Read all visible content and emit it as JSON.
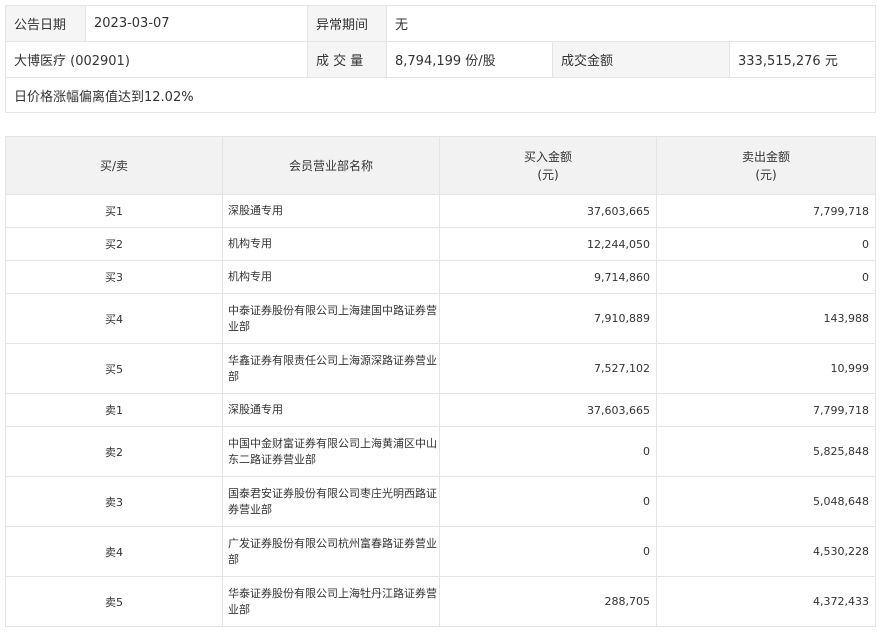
{
  "info": {
    "date_label": "公告日期",
    "date_value": "2023-03-07",
    "period_label": "异常期间",
    "period_value": "无",
    "stock_name": "大博医疗 (002901)",
    "volume_label": "成 交 量",
    "volume_value": "8,794,199 份/股",
    "amount_label": "成交金额",
    "amount_value": "333,515,276 元",
    "note": "日价格涨幅偏离值达到12.02%"
  },
  "table": {
    "headers": {
      "side": "买/卖",
      "dept": "会员营业部名称",
      "buy_line1": "买入金额",
      "buy_line2": "(元)",
      "sell_line1": "卖出金额",
      "sell_line2": "(元)"
    },
    "rows": [
      {
        "side": "买1",
        "dept": "深股通专用",
        "buy": "37,603,665",
        "sell": "7,799,718"
      },
      {
        "side": "买2",
        "dept": "机构专用",
        "buy": "12,244,050",
        "sell": "0"
      },
      {
        "side": "买3",
        "dept": "机构专用",
        "buy": "9,714,860",
        "sell": "0"
      },
      {
        "side": "买4",
        "dept": "中泰证券股份有限公司上海建国中路证券营业部",
        "buy": "7,910,889",
        "sell": "143,988"
      },
      {
        "side": "买5",
        "dept": "华鑫证券有限责任公司上海源深路证券营业部",
        "buy": "7,527,102",
        "sell": "10,999"
      },
      {
        "side": "卖1",
        "dept": "深股通专用",
        "buy": "37,603,665",
        "sell": "7,799,718"
      },
      {
        "side": "卖2",
        "dept": "中国中金财富证券有限公司上海黄浦区中山东二路证券营业部",
        "buy": "0",
        "sell": "5,825,848"
      },
      {
        "side": "卖3",
        "dept": "国泰君安证券股份有限公司枣庄光明西路证券营业部",
        "buy": "0",
        "sell": "5,048,648"
      },
      {
        "side": "卖4",
        "dept": "广发证券股份有限公司杭州富春路证券营业部",
        "buy": "0",
        "sell": "4,530,228"
      },
      {
        "side": "卖5",
        "dept": "华泰证券股份有限公司上海牡丹江路证券营业部",
        "buy": "288,705",
        "sell": "4,372,433"
      }
    ]
  }
}
